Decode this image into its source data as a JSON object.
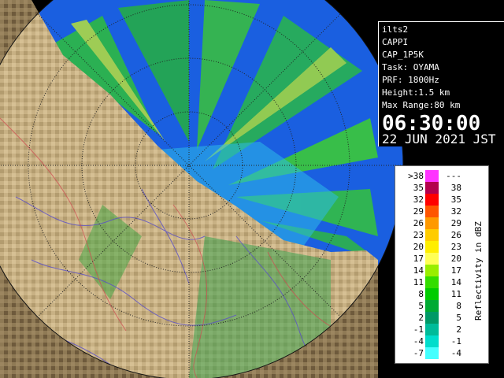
{
  "info": {
    "lines": [
      "ilts2",
      "CAPPI",
      "CAP_1P5K",
      "Task: OYAMA",
      "PRF: 1800Hz",
      "Height:1.5 km",
      "Max Range:80 km"
    ],
    "time": "06:30:00",
    "date": "22 JUN 2021 JST"
  },
  "legend": {
    "caption": "Reflectivity in dBZ",
    "rows": [
      {
        "lo": ">38",
        "hi": "---",
        "color": "#ff33ff"
      },
      {
        "lo": "35",
        "hi": "38",
        "color": "#b3004d"
      },
      {
        "lo": "32",
        "hi": "35",
        "color": "#ff0000"
      },
      {
        "lo": "29",
        "hi": "32",
        "color": "#ff5500"
      },
      {
        "lo": "26",
        "hi": "29",
        "color": "#ff9900"
      },
      {
        "lo": "23",
        "hi": "26",
        "color": "#ffcc00"
      },
      {
        "lo": "20",
        "hi": "23",
        "color": "#ffee00"
      },
      {
        "lo": "17",
        "hi": "20",
        "color": "#ffff55"
      },
      {
        "lo": "14",
        "hi": "17",
        "color": "#99ee00"
      },
      {
        "lo": "11",
        "hi": "14",
        "color": "#33dd00"
      },
      {
        "lo": "8",
        "hi": "11",
        "color": "#00cc00"
      },
      {
        "lo": "5",
        "hi": "8",
        "color": "#00aa33"
      },
      {
        "lo": "2",
        "hi": "5",
        "color": "#009966"
      },
      {
        "lo": "-1",
        "hi": "2",
        "color": "#00bb99"
      },
      {
        "lo": "-4",
        "hi": "-1",
        "color": "#00ddcc"
      },
      {
        "lo": "-7",
        "hi": "-4",
        "color": "#44ffff"
      }
    ]
  },
  "colors": {
    "land": "#8f7a55",
    "land_light": "#c8b184",
    "sea_echo": "#1a5fe0",
    "rings": "#222222"
  }
}
